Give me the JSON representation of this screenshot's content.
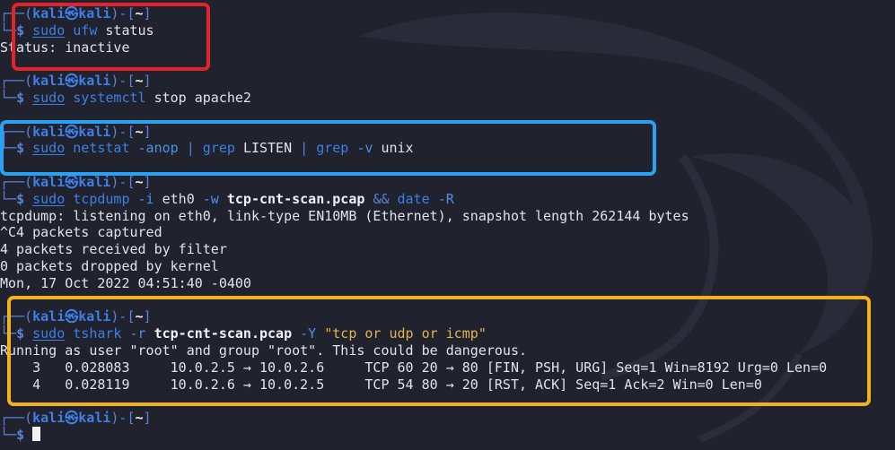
{
  "prompt": {
    "user": "kali",
    "at": "㉿",
    "host": "kali",
    "cwd": "~"
  },
  "colors": {
    "red_box": "#e3222a",
    "blue_box": "#2aa1f2",
    "yellow_box": "#f4b11f",
    "prompt_blue": "#3f7ee6",
    "string_yellow": "#e3b34f",
    "background": "#20232d"
  },
  "blocks": [
    {
      "command": {
        "sudo": "sudo",
        "cmd": "ufw",
        "rest": " status"
      },
      "output": [
        "Status: inactive"
      ]
    },
    {
      "command": {
        "sudo": "sudo",
        "cmd": "systemctl",
        "rest": " stop apache2"
      },
      "output": []
    },
    {
      "command": {
        "sudo": "sudo",
        "cmd": "netstat",
        "flag": "-anop",
        "pipe1": "|",
        "grep1": "grep",
        "arg1": "LISTEN",
        "pipe2": "|",
        "grep2": "grep",
        "flag2": "-v",
        "arg2": "unix"
      },
      "output": []
    },
    {
      "command": {
        "sudo": "sudo",
        "cmd": "tcpdump",
        "flag1": "-i",
        "arg1": "eth0",
        "flag2": "-w",
        "file": "tcp-cnt-scan.pcap",
        "op": "&&",
        "cmd2": "date",
        "flag3": "-R"
      },
      "output": [
        "tcpdump: listening on eth0, link-type EN10MB (Ethernet), snapshot length 262144 bytes",
        "^C4 packets captured",
        "4 packets received by filter",
        "0 packets dropped by kernel",
        "Mon, 17 Oct 2022 04:51:40 -0400"
      ]
    },
    {
      "command": {
        "sudo": "sudo",
        "cmd": "tshark",
        "flag1": "-r",
        "file": "tcp-cnt-scan.pcap",
        "flag2": "-Y",
        "filter": "\"tcp or udp or icmp\""
      },
      "output": [
        "Running as user \"root\" and group \"root\". This could be dangerous.",
        "    3   0.028083     10.0.2.5 → 10.0.2.6     TCP 60 20 → 80 [FIN, PSH, URG] Seq=1 Win=8192 Urg=0 Len=0",
        "    4   0.028119     10.0.2.6 → 10.0.2.5     TCP 54 80 → 20 [RST, ACK] Seq=1 Ack=2 Win=0 Len=0"
      ]
    }
  ]
}
